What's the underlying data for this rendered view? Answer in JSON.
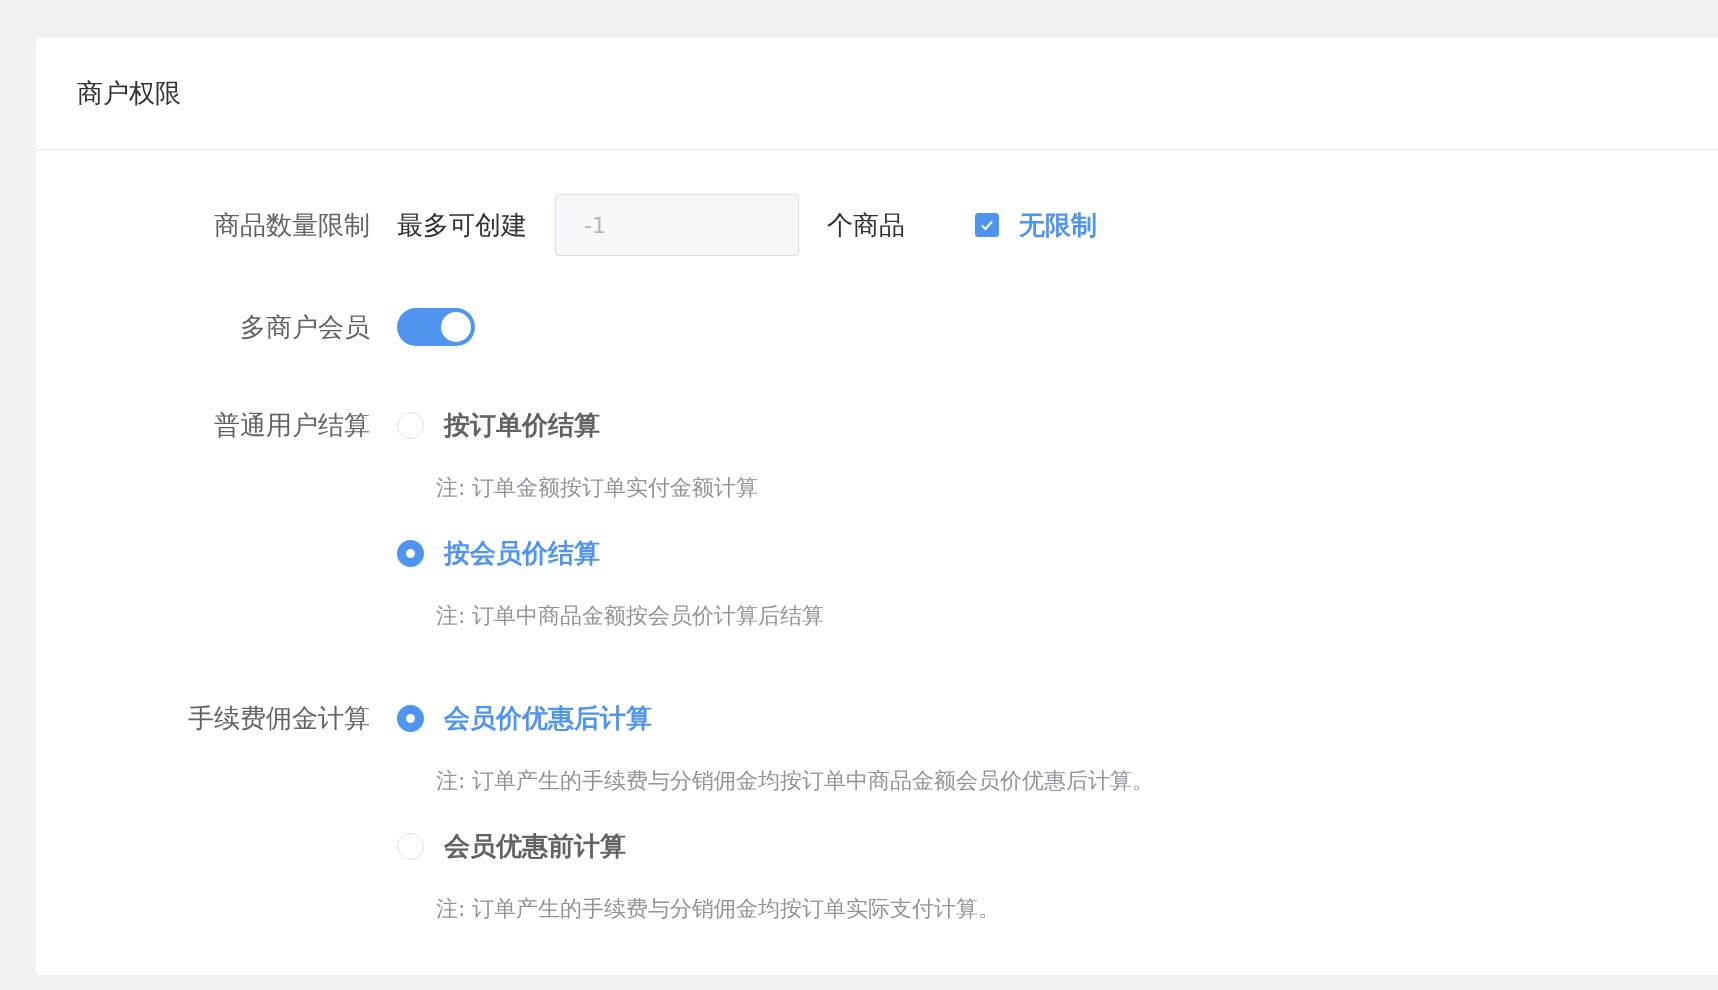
{
  "card": {
    "title": "商户权限"
  },
  "product_limit": {
    "label": "商品数量限制",
    "prefix": "最多可创建",
    "input": {
      "value": "-1",
      "disabled": true
    },
    "suffix": "个商品",
    "unlimited": {
      "label": "无限制",
      "checked": true
    }
  },
  "member": {
    "label": "多商户会员",
    "on": true
  },
  "settlement": {
    "label": "普通用户结算",
    "options": [
      {
        "label": "按订单价结算",
        "note": "注: 订单金额按订单实付金额计算",
        "selected": false
      },
      {
        "label": "按会员价结算",
        "note": "注: 订单中商品金额按会员价计算后结算",
        "selected": true
      }
    ]
  },
  "commission": {
    "label": "手续费佣金计算",
    "options": [
      {
        "label": "会员价优惠后计算",
        "note": "注: 订单产生的手续费与分销佣金均按订单中商品金额会员价优惠后计算。",
        "selected": true
      },
      {
        "label": "会员优惠前计算",
        "note": "注: 订单产生的手续费与分销佣金均按订单实际支付计算。",
        "selected": false
      }
    ]
  }
}
